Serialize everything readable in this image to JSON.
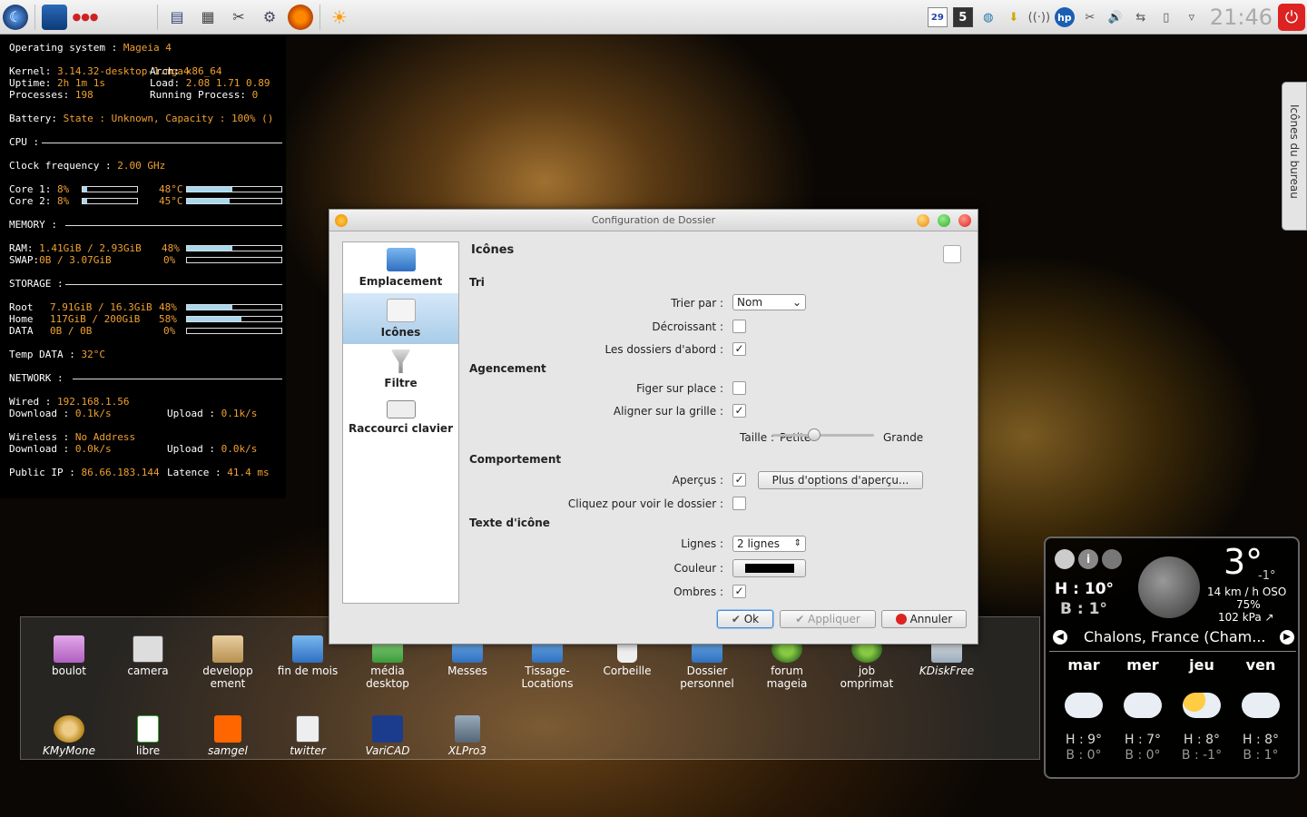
{
  "colors": {
    "accent": "#f0a030",
    "selection": "#a8cce8",
    "power": "#d22222"
  },
  "topbar": {
    "icons": [
      "mageia-menu-icon",
      "desktop-icon",
      "dots-icon",
      "pager-icon",
      "monitor-icon",
      "calculator-icon",
      "tools-icon",
      "settings-icon",
      "firefox-icon",
      "sun-icon"
    ],
    "tray": {
      "calendar_day": "29",
      "badge": "5"
    },
    "clock": "21:46"
  },
  "conky": {
    "os_label": "Operating system :",
    "os_value": "Mageia 4",
    "kernel_label": "Kernel:",
    "kernel_value": "3.14.32-desktop-1.mga4",
    "arch_label": "Arch:",
    "arch_value": "x86_64",
    "uptime_label": "Uptime:",
    "uptime_value": "2h 1m 1s",
    "load_label": "Load:",
    "load_value": "2.08 1.71 0.89",
    "processes_label": "Processes:",
    "processes_value": "198",
    "running_label": "Running Process:",
    "running_value": "0",
    "battery_label": "Battery:",
    "battery_value": "State : Unknown,  Capacity : 100%  ()",
    "cpu_label": "CPU :",
    "clock_label": "Clock frequency :",
    "clock_value": "2.00 GHz",
    "core1_label": "Core 1:",
    "core1_value": "8%",
    "core1_pct": 8,
    "core1_temp": "48°C",
    "core1_temp_pct": 48,
    "core2_label": "Core 2:",
    "core2_value": "8%",
    "core2_pct": 8,
    "core2_temp": "45°C",
    "core2_temp_pct": 45,
    "memory_label": "MEMORY :",
    "ram_label": "RAM:",
    "ram_value": "1.41GiB / 2.93GiB",
    "ram_pct_text": "48%",
    "ram_pct": 48,
    "swap_label": "SWAP:",
    "swap_value": "0B   / 3.07GiB",
    "swap_pct_text": "0%",
    "swap_pct": 0,
    "storage_label": "STORAGE :",
    "root_label": "Root",
    "root_value": "7.91GiB / 16.3GiB",
    "root_pct_text": "48%",
    "root_pct": 48,
    "home_label": "Home",
    "home_value": "117GiB / 200GiB",
    "home_pct_text": "58%",
    "home_pct": 58,
    "data_label": "DATA",
    "data_value": "0B   / 0B",
    "data_pct_text": "0%",
    "data_pct": 0,
    "temp_label": "Temp DATA :",
    "temp_value": "32°C",
    "network_label": "NETWORK :",
    "wired_label": "Wired :",
    "wired_value": "192.168.1.56",
    "dl1_label": "Download :",
    "dl1_value": "0.1k/s",
    "ul1_label": "Upload :",
    "ul1_value": "0.1k/s",
    "wireless_label": "Wireless :",
    "wireless_value": "No Address",
    "dl2_label": "Download :",
    "dl2_value": "0.0k/s",
    "ul2_label": "Upload :",
    "ul2_value": "0.0k/s",
    "ip_label": "Public IP :",
    "ip_value": "86.66.183.144",
    "latency_label": "Latence :",
    "latency_value": "41.4 ms"
  },
  "vtab": {
    "label": "Icônes du bureau"
  },
  "dialog": {
    "title": "Configuration de Dossier",
    "sidebar": [
      {
        "label": "Emplacement",
        "icon": "folder-icon"
      },
      {
        "label": "Icônes",
        "icon": "icons-icon"
      },
      {
        "label": "Filtre",
        "icon": "funnel-icon"
      },
      {
        "label": "Raccourci clavier",
        "icon": "keyboard-icon"
      }
    ],
    "heading": "Icônes",
    "sections": {
      "tri": "Tri",
      "agencement": "Agencement",
      "comportement": "Comportement",
      "texte": "Texte d'icône"
    },
    "labels": {
      "trier": "Trier par :",
      "decroissant": "Décroissant :",
      "dossiers": "Les dossiers d'abord :",
      "figer": "Figer sur place :",
      "aligner": "Aligner sur la grille :",
      "taille": "Taille :",
      "apercus": "Aperçus :",
      "cliquez": "Cliquez pour voir le dossier :",
      "lignes": "Lignes :",
      "couleur": "Couleur :",
      "ombres": "Ombres :"
    },
    "values": {
      "trier": "Nom",
      "lignes": "2 lignes",
      "size_min": "Petite",
      "size_max": "Grande",
      "size_level": 0.4,
      "decroissant": false,
      "dossiers": true,
      "figer": false,
      "aligner": true,
      "apercus": true,
      "cliquez": false,
      "ombres": true,
      "couleur": "#000000"
    },
    "buttons": {
      "plus": "Plus d'options d'aperçu...",
      "ok": "Ok",
      "appliquer": "Appliquer",
      "annuler": "Annuler"
    }
  },
  "desktop": {
    "row1": [
      "boulot",
      "camera",
      "developp ement",
      "fin de mois",
      "média desktop",
      "Messes",
      "Tissage-Locations",
      "Corbeille",
      "Dossier personnel",
      "forum mageia",
      "job omprimat",
      "KDiskFree"
    ],
    "row2": [
      "KMyMone",
      "libre",
      "samgel",
      "twitter",
      "VariCAD",
      "XLPro3"
    ]
  },
  "weather": {
    "now_temp": "3°",
    "now_low": "-1°",
    "high": "H : 10°",
    "low": "B : 1°",
    "wind": "14 km / h OSO",
    "humidity": "75%",
    "pressure": "102 kPa ↗",
    "location": "Chalons, France (Cham...",
    "days": [
      {
        "name": "mar",
        "high": "H : 9°",
        "low": "B : 0°"
      },
      {
        "name": "mer",
        "high": "H : 7°",
        "low": "B : 0°"
      },
      {
        "name": "jeu",
        "high": "H : 8°",
        "low": "B : -1°"
      },
      {
        "name": "ven",
        "high": "H : 8°",
        "low": "B : 1°"
      }
    ]
  }
}
